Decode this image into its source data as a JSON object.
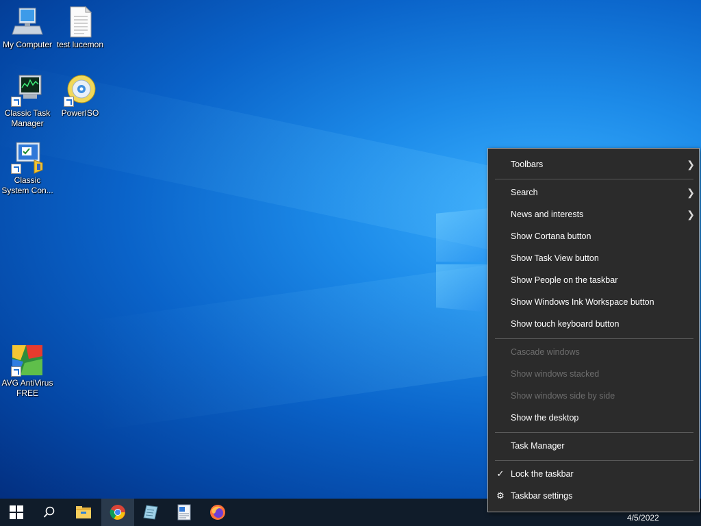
{
  "desktop": {
    "icons": [
      {
        "label": "My Computer",
        "icon": "computer-icon"
      },
      {
        "label": "test lucemon",
        "icon": "document-icon"
      },
      {
        "label": "Classic Task Manager",
        "icon": "task-manager-icon"
      },
      {
        "label": "PowerISO",
        "icon": "disc-icon"
      },
      {
        "label": "Classic System Con...",
        "icon": "control-panel-icon"
      },
      {
        "label": "AVG AntiVirus FREE",
        "icon": "avg-icon"
      }
    ]
  },
  "context_menu": {
    "items": [
      {
        "label": "Toolbars",
        "submenu": true
      },
      {
        "label": "Search",
        "submenu": true
      },
      {
        "label": "News and interests",
        "submenu": true
      },
      {
        "label": "Show Cortana button"
      },
      {
        "label": "Show Task View button"
      },
      {
        "label": "Show People on the taskbar"
      },
      {
        "label": "Show Windows Ink Workspace button"
      },
      {
        "label": "Show touch keyboard button"
      },
      {
        "label": "Cascade windows",
        "disabled": true
      },
      {
        "label": "Show windows stacked",
        "disabled": true
      },
      {
        "label": "Show windows side by side",
        "disabled": true
      },
      {
        "label": "Show the desktop"
      },
      {
        "label": "Task Manager"
      },
      {
        "label": "Lock the taskbar",
        "checked": true
      },
      {
        "label": "Taskbar settings",
        "icon": "gear-icon"
      }
    ]
  },
  "taskbar": {
    "buttons": [
      "start-icon",
      "search-icon",
      "file-explorer-icon",
      "chrome-icon",
      "notepad-icon",
      "wordpad-icon",
      "firefox-icon"
    ],
    "date": "4/5/2022"
  },
  "colors": {
    "menu_bg": "#2b2b2b",
    "taskbar_bg": "#101c2a",
    "accent": "#0a63c9"
  }
}
